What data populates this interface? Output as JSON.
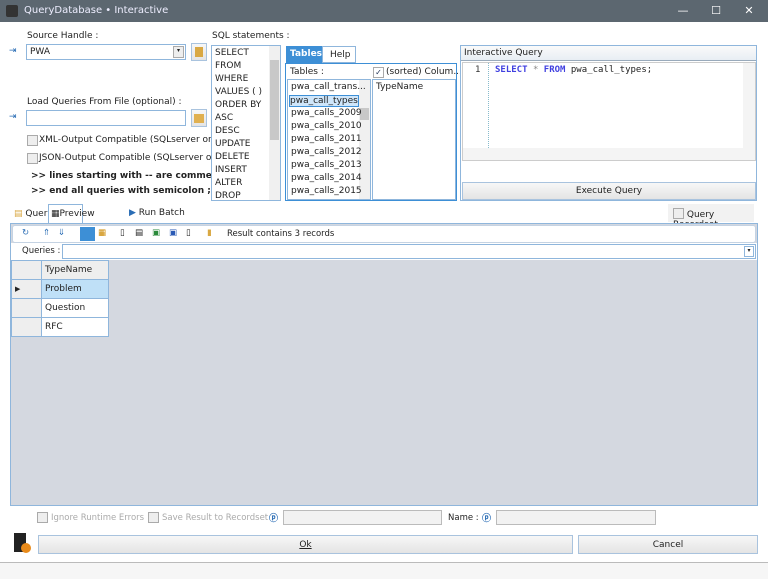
{
  "window": {
    "title": "QueryDatabase • Interactive",
    "controls": [
      "minimize",
      "maximize",
      "close"
    ]
  },
  "source": {
    "label": "Source Handle :",
    "value": "PWA"
  },
  "load": {
    "label": "Load Queries From File (optional) :",
    "value": ""
  },
  "options": {
    "xml": "XML-Output Compatible (SQLserver only)",
    "json": "JSON-Output Compatible (SQLserver only)",
    "hint1": ">> lines starting with -- are comment",
    "hint2": ">> end all queries with semicolon ;"
  },
  "sql": {
    "label": "SQL statements :",
    "items": [
      "SELECT",
      "FROM",
      "WHERE",
      "VALUES ( )",
      "ORDER BY",
      "ASC",
      "DESC",
      "UPDATE",
      "DELETE",
      "INSERT",
      "ALTER",
      "DROP"
    ]
  },
  "tables": {
    "tabs": [
      "Tables",
      "Help"
    ],
    "label": "Tables :",
    "sorted_label": "(sorted)  Colum...",
    "sorted_checked": true,
    "items": [
      "pwa_call_trans...",
      "pwa_call_types",
      "pwa_calls_2009",
      "pwa_calls_2010",
      "pwa_calls_2011",
      "pwa_calls_2012",
      "pwa_calls_2013",
      "pwa_calls_2014",
      "pwa_calls_2015"
    ],
    "selected": "pwa_call_types",
    "columns": [
      "TypeName"
    ]
  },
  "query": {
    "title": "Interactive Query",
    "line": "1",
    "kw1": "SELECT",
    "op": "*",
    "kw2": "FROM",
    "rest": "pwa_call_types;",
    "execute": "Execute Query"
  },
  "tabs": {
    "items": [
      "Queries",
      "Preview",
      "Run Batch"
    ],
    "active": "Preview",
    "recordset": "Query Recordset"
  },
  "toolbar": {
    "status": "Result contains 3 records"
  },
  "queries": {
    "label": "Queries :",
    "value": ""
  },
  "grid": {
    "header": "TypeName",
    "rows": [
      "Problem",
      "Question",
      "RFC"
    ]
  },
  "bottom": {
    "ignore": "Ignore Runtime Errors",
    "save": "Save Result to Recordset :",
    "name": "Name :",
    "ok": "Ok",
    "cancel": "Cancel"
  }
}
